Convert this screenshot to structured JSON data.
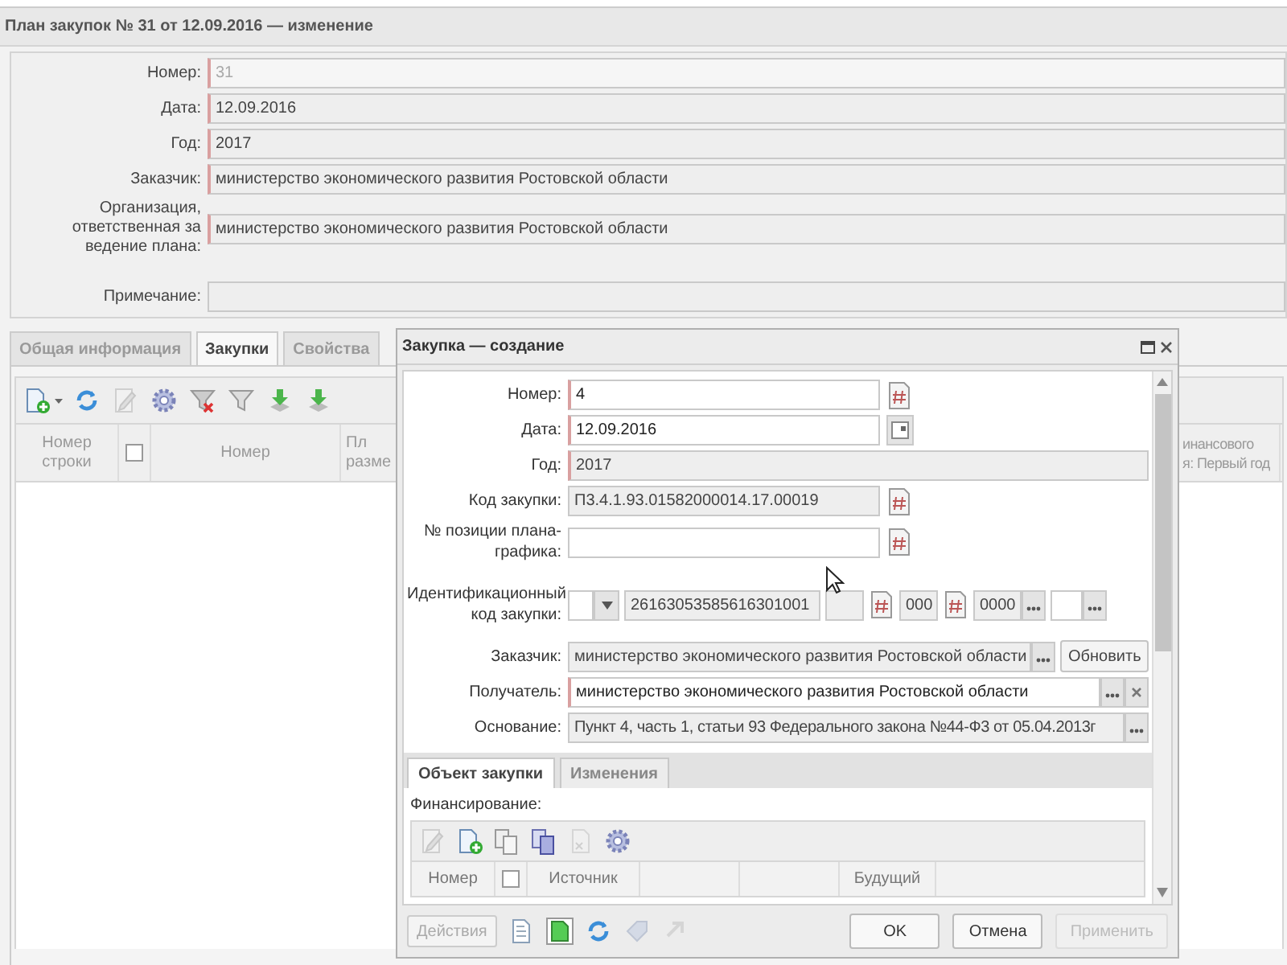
{
  "window": {
    "title": "План закупок № 31 от 12.09.2016 — изменение"
  },
  "plan_form": [
    {
      "label": "Номер:",
      "value": "31",
      "required": true,
      "disabled": true
    },
    {
      "label": "Дата:",
      "value": "12.09.2016",
      "required": true,
      "disabled": false
    },
    {
      "label": "Год:",
      "value": "2017",
      "required": true,
      "disabled": false
    },
    {
      "label": "Заказчик:",
      "value": "министерство экономического развития Ростовской области",
      "required": true,
      "disabled": false
    },
    {
      "label": "Организация, ответственная за ведение плана:",
      "value": "министерство экономического развития Ростовской области",
      "required": true,
      "disabled": false
    },
    {
      "label": "Примечание:",
      "required": false
    }
  ],
  "tabs": [
    {
      "label": "Общая информация",
      "selected": false
    },
    {
      "label": "Закупки",
      "selected": true
    },
    {
      "label": "Свойства",
      "selected": false
    }
  ],
  "grid": {
    "columns": [
      {
        "kind": "text",
        "label": "Номер\nстроки"
      },
      {
        "kind": "checkbox",
        "checked": false
      },
      {
        "kind": "text",
        "label": "Номер"
      },
      {
        "kind": "text",
        "label": "Пл\nразме"
      },
      {
        "kind": "text",
        "label": "инансового\nя: Первый год"
      }
    ]
  },
  "dialog": {
    "title": "Закупка — создание",
    "fields": [
      {
        "kind": "hash",
        "label": "Номер:",
        "value": "4",
        "required": true,
        "editable": true
      },
      {
        "kind": "date",
        "label": "Дата:",
        "value": "12.09.2016",
        "required": true,
        "editable": true
      },
      {
        "kind": "plain",
        "label": "Год:",
        "value": "2017",
        "required": true,
        "editable": false
      },
      {
        "kind": "hash",
        "label": "Код закупки:",
        "value": "П3.4.1.93.01582000014.17.00019",
        "required": false,
        "editable": false
      },
      {
        "kind": "hash",
        "label": "№ позиции плана-графика:",
        "required": false,
        "editable": true
      },
      {
        "kind": "ikz",
        "label": "Идентификационный код закупки:",
        "parts": [
          "26163053585616301001",
          "000",
          "0000"
        ]
      },
      {
        "kind": "refresh",
        "label": "Заказчик:",
        "value": "министерство экономического развития Ростовской области",
        "button": "Обновить",
        "required": false,
        "editable": false
      },
      {
        "kind": "clearable",
        "label": "Получатель:",
        "value": "министерство экономического развития Ростовской области",
        "required": true,
        "editable": true
      },
      {
        "kind": "lookup",
        "label": "Основание:",
        "value": "Пункт 4, часть 1, статьи 93 Федерального закона №44-Ф3 от 05.04.2013г",
        "required": false,
        "editable": false
      }
    ],
    "tabs": [
      {
        "label": "Объект закупки",
        "selected": true
      },
      {
        "label": "Изменения",
        "selected": false
      }
    ],
    "section_label": "Финансирование:",
    "grid_columns": [
      {
        "kind": "text",
        "label": "Номер"
      },
      {
        "kind": "checkbox",
        "checked": false
      },
      {
        "kind": "text",
        "label": "Источник"
      },
      {
        "kind": "text"
      },
      {
        "kind": "text"
      },
      {
        "kind": "text",
        "label": "Будущий"
      }
    ],
    "actions": {
      "label": "Действия",
      "disabled": true
    },
    "buttons": [
      {
        "label": "OK",
        "disabled": false
      },
      {
        "label": "Отмена",
        "disabled": false
      },
      {
        "label": "Применить",
        "disabled": true
      }
    ]
  }
}
